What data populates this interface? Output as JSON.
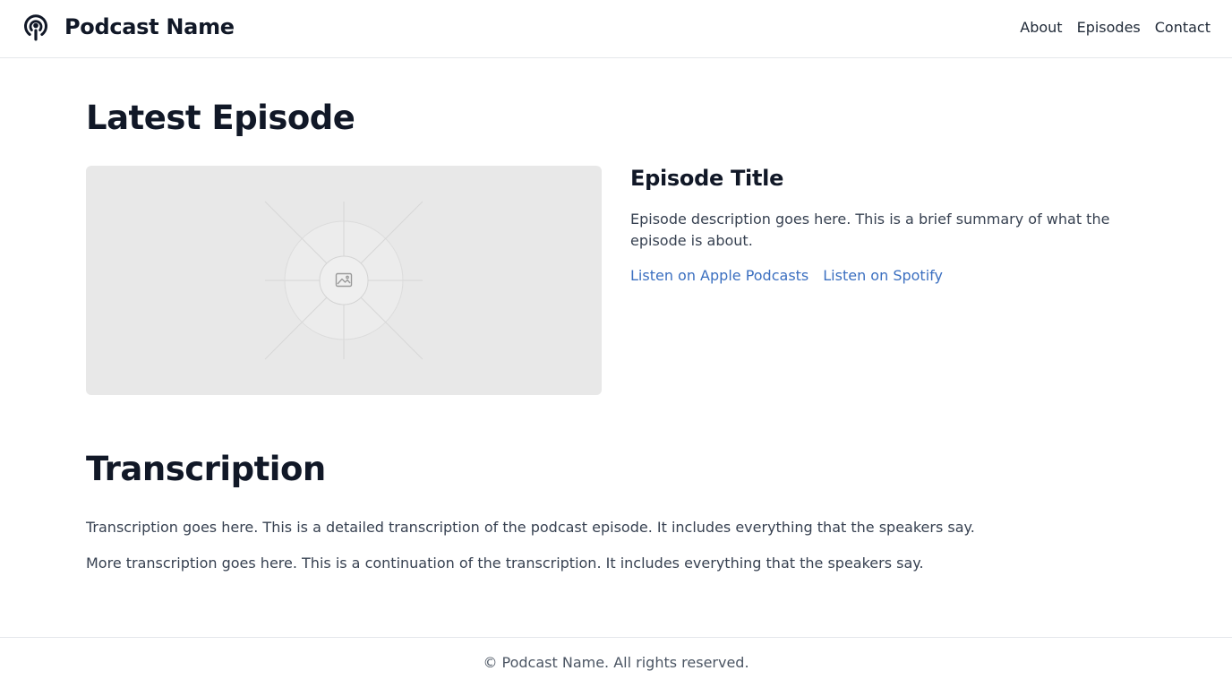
{
  "header": {
    "brand_icon": "podcast-icon",
    "title": "Podcast Name",
    "nav": [
      "About",
      "Episodes",
      "Contact"
    ]
  },
  "latest": {
    "heading": "Latest Episode",
    "image_icon": "image-placeholder-icon",
    "episode_title": "Episode Title",
    "description": "Episode description goes here. This is a brief summary of what the episode is about.",
    "links": [
      "Listen on Apple Podcasts",
      "Listen on Spotify"
    ]
  },
  "transcription": {
    "heading": "Transcription",
    "paragraphs": [
      "Transcription goes here. This is a detailed transcription of the podcast episode. It includes everything that the speakers say.",
      "More transcription goes here. This is a continuation of the transcription. It includes everything that the speakers say."
    ]
  },
  "footer": {
    "text": "© Podcast Name. All rights reserved."
  },
  "colors": {
    "link": "#3b6fc0",
    "heading": "#111827",
    "body_text": "#374151",
    "placeholder_bg": "#e8e8e8",
    "border": "#e5e7eb"
  }
}
